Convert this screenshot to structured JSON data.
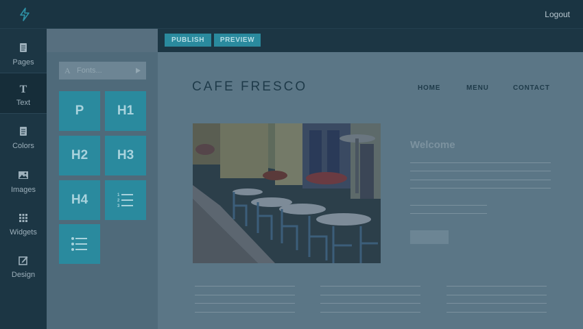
{
  "header": {
    "logout_label": "Logout"
  },
  "sidebar": {
    "items": [
      {
        "label": "Pages",
        "icon": "pages-icon"
      },
      {
        "label": "Text",
        "icon": "text-icon",
        "active": true
      },
      {
        "label": "Colors",
        "icon": "colors-icon"
      },
      {
        "label": "Images",
        "icon": "images-icon"
      },
      {
        "label": "Widgets",
        "icon": "widgets-icon"
      },
      {
        "label": "Design",
        "icon": "design-icon"
      }
    ]
  },
  "text_panel": {
    "font_search": {
      "placeholder": "Fonts..."
    },
    "tiles": [
      {
        "label": "P"
      },
      {
        "label": "H1"
      },
      {
        "label": "H2"
      },
      {
        "label": "H3"
      },
      {
        "label": "H4"
      },
      {
        "label": "",
        "icon": "numbered-list-icon"
      },
      {
        "label": "",
        "icon": "bulleted-list-icon"
      }
    ]
  },
  "toolbar": {
    "publish_label": "PUBLISH",
    "preview_label": "PREVIEW"
  },
  "site": {
    "title": "CAFE FRESCO",
    "nav": [
      "HOME",
      "MENU",
      "CONTACT"
    ],
    "welcome": "Welcome",
    "photo": "cafe-terrace-photo"
  },
  "colors": {
    "accent": "#2a8a9e",
    "topbar": "#1a3442",
    "canvas_overlay": "#5b7686"
  }
}
